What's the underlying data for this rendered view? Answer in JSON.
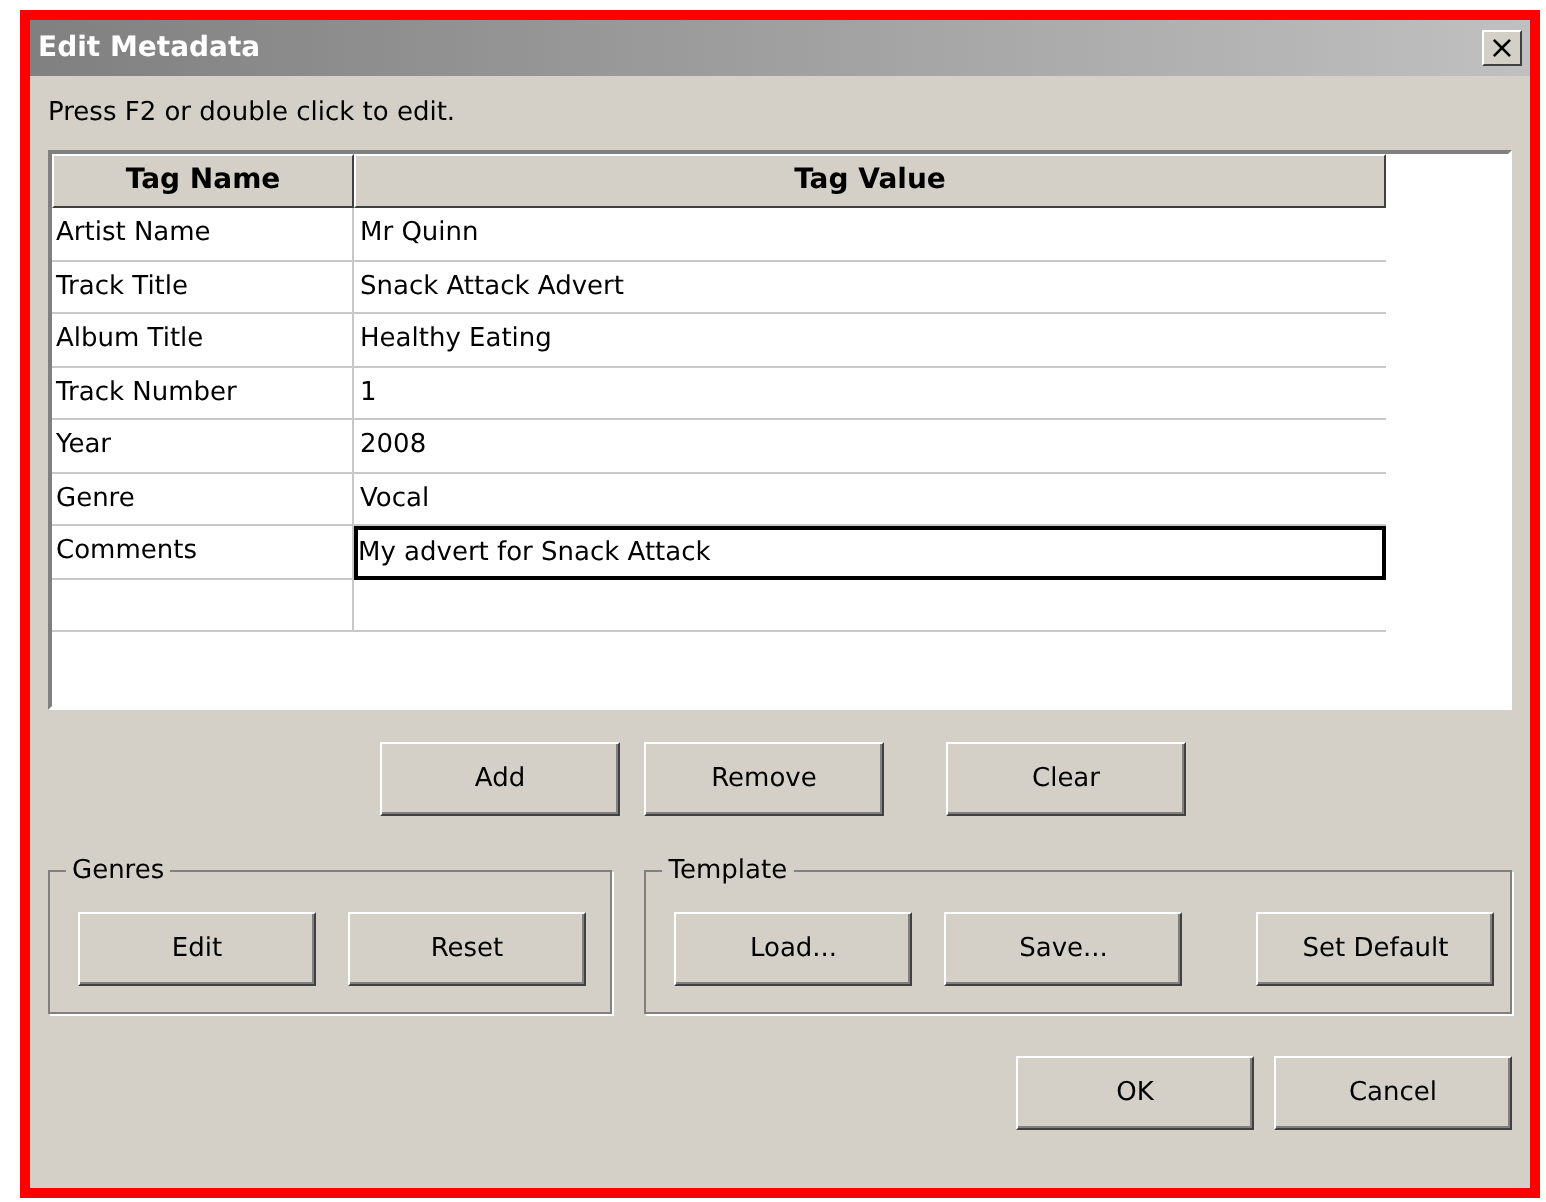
{
  "window": {
    "title": "Edit Metadata",
    "close": "×"
  },
  "instruction": "Press F2 or double click to edit.",
  "table": {
    "columns": [
      "Tag Name",
      "Tag Value"
    ],
    "rows": [
      {
        "name": "Artist Name",
        "value": "Mr Quinn",
        "editing": false
      },
      {
        "name": "Track Title",
        "value": "Snack Attack Advert",
        "editing": false
      },
      {
        "name": "Album Title",
        "value": "Healthy Eating",
        "editing": false
      },
      {
        "name": "Track Number",
        "value": "1",
        "editing": false
      },
      {
        "name": "Year",
        "value": "2008",
        "editing": false
      },
      {
        "name": "Genre",
        "value": "Vocal",
        "editing": false
      },
      {
        "name": "Comments",
        "value": "My advert for Snack Attack",
        "editing": true
      }
    ]
  },
  "row_buttons": [
    "Add",
    "Remove",
    "Clear"
  ],
  "genres": {
    "title": "Genres",
    "buttons": [
      "Edit",
      "Reset"
    ]
  },
  "template": {
    "title": "Template",
    "buttons": [
      "Load...",
      "Save...",
      "Set Default"
    ]
  },
  "dialog_buttons": [
    "OK",
    "Cancel"
  ]
}
